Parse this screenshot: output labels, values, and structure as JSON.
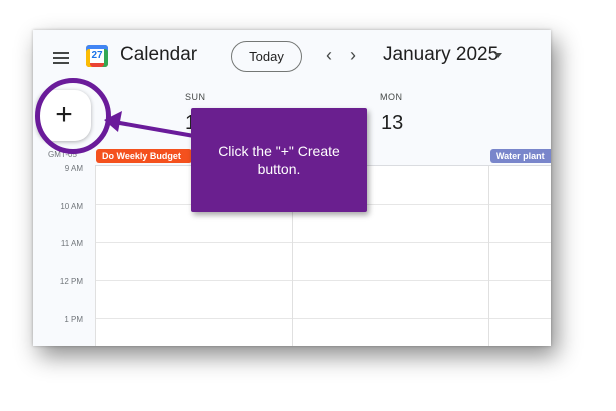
{
  "header": {
    "menu_icon": "hamburger-menu-icon",
    "logo_text": "27",
    "app_title": "Calendar",
    "today_label": "Today",
    "prev_label": "‹",
    "next_label": "›",
    "month_label": "January 2025",
    "month_dropdown_icon": "caret-down-icon"
  },
  "create_button": {
    "label": "+"
  },
  "days": [
    {
      "name": "SUN",
      "number": "1"
    },
    {
      "name": "MON",
      "number": "13"
    }
  ],
  "timezone": "GMT-05",
  "all_day_events": [
    {
      "title": "Do Weekly Budget",
      "color": "#f4511e"
    },
    {
      "title": "Water plant",
      "color": "#7986cb"
    }
  ],
  "hours": [
    "9 AM",
    "10 AM",
    "11 AM",
    "12 PM",
    "1 PM"
  ],
  "callout": {
    "text": "Click the \"+\" Create button.",
    "color": "#6a1f8f"
  },
  "colors": {
    "highlight_ring": "#6a1b9a",
    "arrow": "#6a1b9a"
  }
}
